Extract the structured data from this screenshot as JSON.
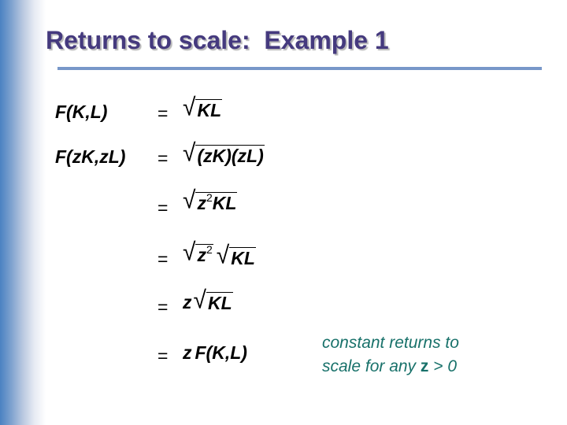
{
  "slide": {
    "title": "Returns to scale:  Example 1",
    "colors": {
      "title": "#453a7e",
      "rule": "#7897c9",
      "note": "#18716a",
      "gradient": "#4a82c2"
    }
  },
  "equations": [
    {
      "lhs": "F(K,L)",
      "sign": "=",
      "rhs_radicand": "KL"
    },
    {
      "lhs": "F(zK,zL)",
      "sign": "=",
      "rhs_radicand": "(zK)(zL)"
    },
    {
      "sign": "=",
      "rhs_radicand_base": "z",
      "rhs_radicand_exp": "2",
      "rhs_radicand_rest": "KL"
    },
    {
      "sign": "=",
      "rhs_radicand_base": "z",
      "rhs_radicand_exp": "2",
      "rhs_radicand_2": "KL"
    },
    {
      "sign": "=",
      "rhs_prefix": "z",
      "rhs_radicand": "KL"
    },
    {
      "sign": "=",
      "rhs_prefix": "z",
      "rhs_expr": "F(K,L)"
    }
  ],
  "note": {
    "line1": "constant returns to",
    "line2_pre": "scale for any ",
    "line2_var": "z",
    "line2_post": " > 0"
  }
}
